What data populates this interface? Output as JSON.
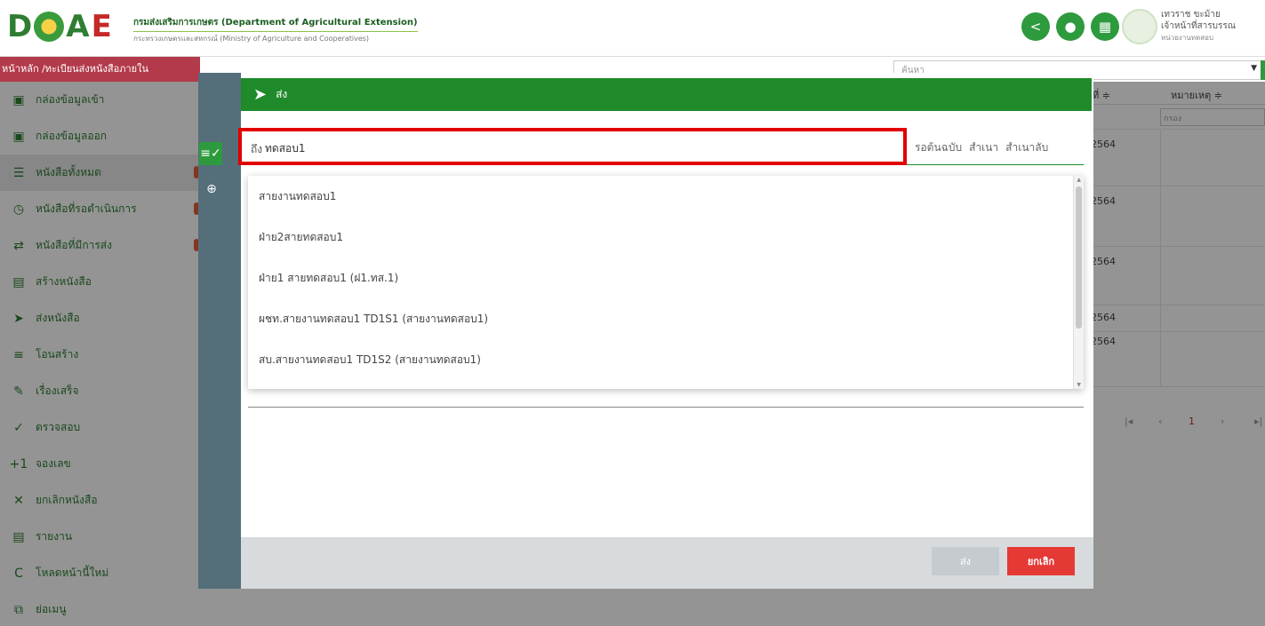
{
  "header": {
    "logo_text": "DOAE",
    "org_name": "กรมส่งเสริมการเกษตร (Department of Agricultural Extension)",
    "org_ministry": "กระทรวงเกษตรและสหกรณ์ (Ministry of Agriculture and Cooperatives)",
    "user_name": "เทวราช ขะม้าย",
    "user_role": "เจ้าหน้าที่สารบรรณ",
    "user_unit": "หน่วยงานทดสอบ"
  },
  "breadcrumb": "หน้าหลัก /ทะเบียนส่งหนังสือภายใน",
  "search_select": {
    "placeholder": "ค้นหา"
  },
  "sidebar": {
    "items": [
      {
        "label": "กล่องข้อมูลเข้า",
        "icon": "inbox-icon"
      },
      {
        "label": "กล่องข้อมูลออก",
        "icon": "outbox-icon"
      },
      {
        "label": "หนังสือทั้งหมด",
        "icon": "list-icon"
      },
      {
        "label": "หนังสือที่รอดำเนินการ",
        "icon": "clock-icon"
      },
      {
        "label": "หนังสือที่มีการส่ง",
        "icon": "transfer-icon"
      },
      {
        "label": "สร้างหนังสือ",
        "icon": "new-doc-icon"
      },
      {
        "label": "ส่งหนังสือ",
        "icon": "send-icon"
      },
      {
        "label": "โอนสร้าง",
        "icon": "transfer-list-icon"
      },
      {
        "label": "เรื่องเสร็จ",
        "icon": "done-icon"
      },
      {
        "label": "ตรวจสอบ",
        "icon": "check-icon"
      },
      {
        "label": "จองเลข",
        "icon": "plus-one-icon"
      },
      {
        "label": "ยกเลิกหนังสือ",
        "icon": "close-icon"
      },
      {
        "label": "รายงาน",
        "icon": "report-icon"
      },
      {
        "label": "โหลดหน้านี้ใหม่",
        "icon": "reload-icon"
      },
      {
        "label": "ย่อเมนู",
        "icon": "collapse-icon"
      }
    ]
  },
  "table": {
    "col_date_header": "ที่ ≑",
    "col_note_header": "หมายเหตุ ≑",
    "filter_placeholder": "กรอง",
    "rows": [
      "2564",
      "2564",
      "2564",
      "2564",
      "2564"
    ],
    "pager": {
      "first": "|◂",
      "prev": "‹",
      "page": "1",
      "next": "›",
      "last": "▸|"
    }
  },
  "modal": {
    "title": "ส่ง",
    "to_label": "ถึง",
    "to_value": "ทดสอบ1",
    "cc_links": [
      "รอต้นฉบับ",
      "สำเนา",
      "สำเนาลับ"
    ],
    "suggestions": [
      "สายงานทดสอบ1",
      "ฝ่าย2สายทดสอบ1",
      "ฝ่าย1 สายทดสอบ1 (ฝ1.ทส.1)",
      "ผชท.สายงานทดสอบ1 TD1S1 (สายงานทดสอบ1)",
      "สบ.สายงานทดสอบ1 TD1S2 (สายงานทดสอบ1)"
    ],
    "send_label": "ส่ง",
    "cancel_label": "ยกเลิก"
  },
  "colors": {
    "brand_green": "#1e8a2a",
    "crumb_red": "#b23a4a",
    "highlight_red": "#e10000",
    "cancel_red": "#e53935"
  }
}
